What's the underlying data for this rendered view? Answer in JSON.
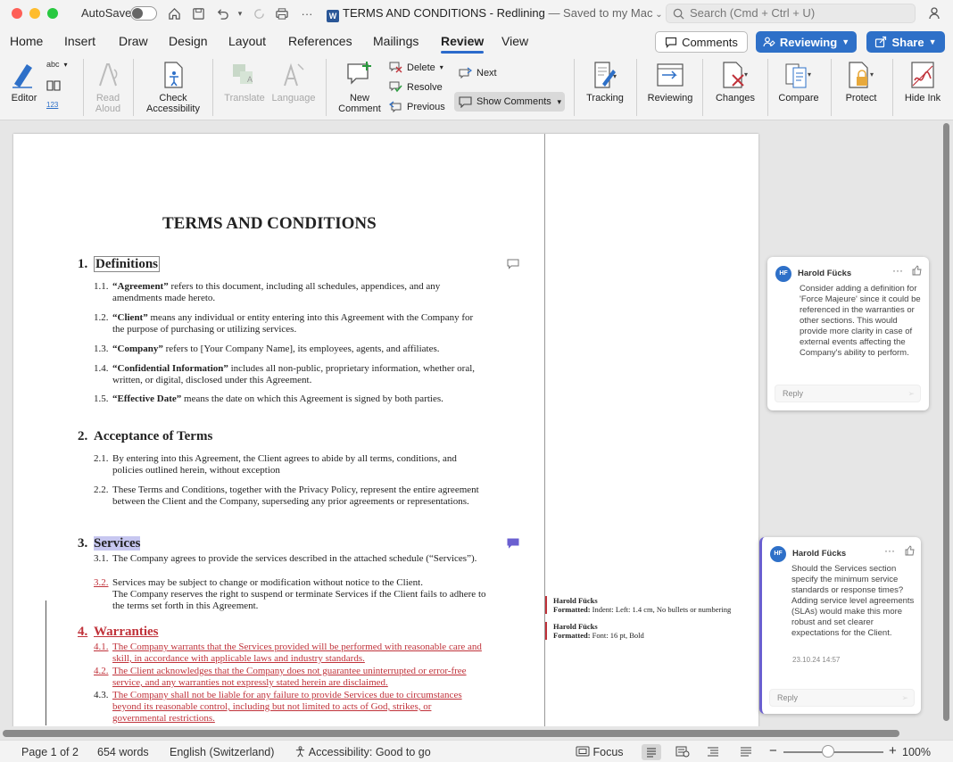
{
  "titlebar": {
    "autosave_label": "AutoSave",
    "doc_name": "TERMS AND CONDITIONS - Redlining",
    "saved_status": " — Saved to my Mac",
    "search_placeholder": "Search (Cmd + Ctrl + U)"
  },
  "tabs": [
    "Home",
    "Insert",
    "Draw",
    "Design",
    "Layout",
    "References",
    "Mailings",
    "Review",
    "View"
  ],
  "active_tab": "Review",
  "header_buttons": {
    "comments": "Comments",
    "reviewing": "Reviewing",
    "share": "Share"
  },
  "ribbon": {
    "editor": "Editor",
    "read_aloud_1": "Read",
    "read_aloud_2": "Aloud",
    "check_accessibility_1": "Check",
    "check_accessibility_2": "Accessibility",
    "translate": "Translate",
    "language": "Language",
    "new_comment_1": "New",
    "new_comment_2": "Comment",
    "delete": "Delete",
    "resolve": "Resolve",
    "previous": "Previous",
    "next": "Next",
    "show_comments": "Show Comments",
    "tracking": "Tracking",
    "reviewing": "Reviewing",
    "changes": "Changes",
    "compare": "Compare",
    "protect": "Protect",
    "hide_ink": "Hide Ink",
    "abc": "abc",
    "num123": "123"
  },
  "document": {
    "title": "TERMS AND CONDITIONS",
    "sections": [
      {
        "num": "1.",
        "heading": "Definitions",
        "items": [
          {
            "n": "1.1.",
            "bold": "“Agreement”",
            "text": " refers to this document, including all schedules, appendices, and any amendments made hereto."
          },
          {
            "n": "1.2.",
            "bold": "“Client”",
            "text": " means any individual or entity entering into this Agreement with the Company for the purpose of purchasing or utilizing services."
          },
          {
            "n": "1.3.",
            "bold": "“Company”",
            "text": " refers to [Your Company Name], its employees, agents, and affiliates."
          },
          {
            "n": "1.4.",
            "bold": "“Confidential Information”",
            "text": " includes all non-public, proprietary information, whether oral, written, or digital, disclosed under this Agreement."
          },
          {
            "n": "1.5.",
            "bold": "“Effective Date”",
            "text": " means the date on which this Agreement is signed by both parties."
          }
        ]
      },
      {
        "num": "2.",
        "heading": "Acceptance of Terms",
        "items": [
          {
            "n": "2.1.",
            "text": "By entering into this Agreement, the Client agrees to abide by all terms, conditions, and policies outlined herein, without exception"
          },
          {
            "n": "2.2.",
            "text": "These Terms and Conditions, together with the Privacy Policy, represent the entire agreement between the Client and the Company, superseding any prior agreements or representations."
          }
        ]
      },
      {
        "num": "3.",
        "heading": "Services",
        "items": [
          {
            "n": "3.1.",
            "text": "The Company agrees to provide the services described in the attached schedule (“Services”)."
          },
          {
            "n": "3.2.",
            "text": "Services may be subject to change or modification without notice to the Client.",
            "text2": "The Company reserves the right to suspend or terminate Services if the Client fails to adhere to the terms set forth in this Agreement."
          }
        ]
      },
      {
        "num": "4.",
        "heading": "Warranties",
        "items": [
          {
            "n": "4.1.",
            "text": "The Company warrants that the Services provided will be performed with reasonable care and skill, in accordance with applicable laws and industry standards."
          },
          {
            "n": "4.2.",
            "text": "The Client acknowledges that the Company does not guarantee uninterrupted or error-free service, and any warranties not expressly stated herein are disclaimed."
          },
          {
            "n": "4.3.",
            "text": "The Company shall not be liable for any failure to provide Services due to circumstances beyond its reasonable control, including but not limited to acts of God, strikes, or governmental restrictions."
          }
        ]
      }
    ],
    "formatting_notes": [
      {
        "author": "Harold Fücks",
        "label": "Formatted:",
        "detail": " Indent: Left:  1.4 cm,  No bullets or numbering"
      },
      {
        "author": "Harold Fücks",
        "label": "Formatted:",
        "detail": " Font: 16 pt, Bold"
      }
    ]
  },
  "comments": [
    {
      "initials": "HF",
      "author": "Harold Fücks",
      "body": "Consider adding a definition for 'Force Majeure' since it could be referenced in the warranties or other sections. This would provide more clarity in case of external events affecting the Company's ability to perform.",
      "reply_placeholder": "Reply"
    },
    {
      "initials": "HF",
      "author": "Harold Fücks",
      "body": "Should the Services section specify the minimum service standards or response times? Adding service level agreements (SLAs) would make this more robust and set clearer expectations for the Client.",
      "date": "23.10.24 14:57",
      "reply_placeholder": "Reply"
    }
  ],
  "status": {
    "page": "Page 1 of 2",
    "words": "654 words",
    "language": "English (Switzerland)",
    "accessibility": "Accessibility: Good to go",
    "focus": "Focus",
    "zoom": "100%"
  },
  "colors": {
    "accent": "#2e70c8",
    "revision": "#c0323a",
    "highlight": "#c7c7f0"
  }
}
